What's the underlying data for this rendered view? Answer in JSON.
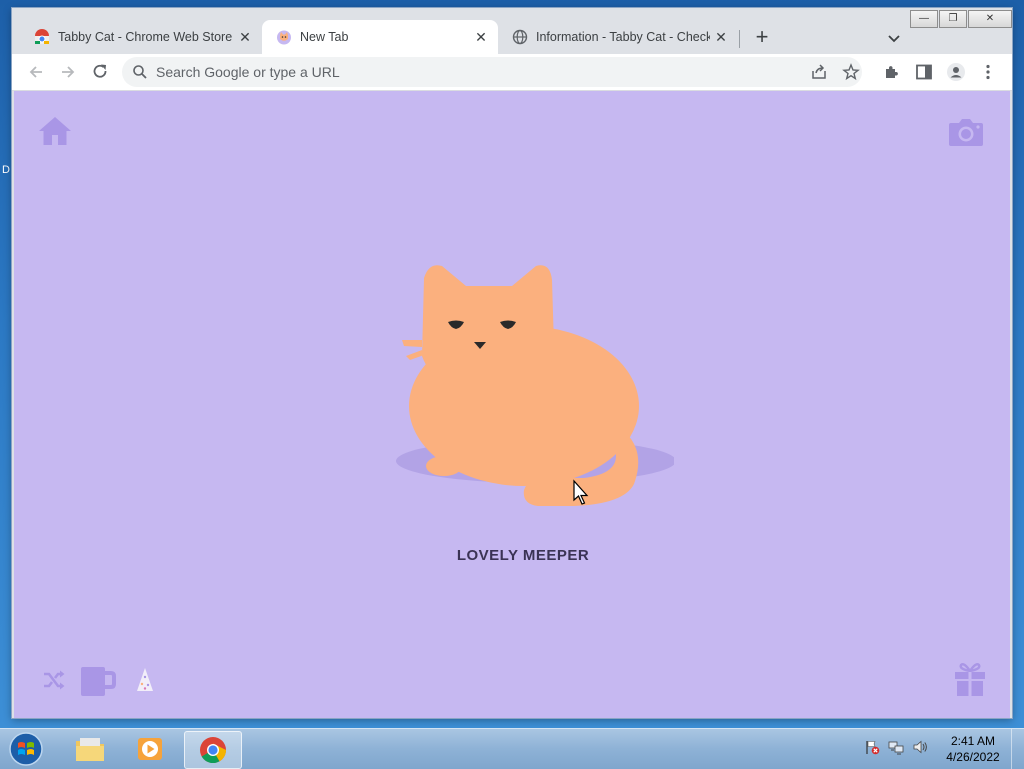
{
  "desktop": {
    "edge_letter": "D"
  },
  "browser": {
    "tabs": [
      {
        "title": "Tabby Cat - Chrome Web Store",
        "active": false
      },
      {
        "title": "New Tab",
        "active": true
      },
      {
        "title": "Information - Tabby Cat - Checkout",
        "active": false
      }
    ],
    "omnibox": {
      "placeholder": "Search Google or type a URL"
    }
  },
  "page": {
    "cat_name": "LOVELY MEEPER",
    "colors": {
      "background": "#c6b8f1",
      "cat": "#fbb07e",
      "shadow": "#b2a3e6",
      "icons": "#a996e6"
    }
  },
  "taskbar": {
    "clock": {
      "time": "2:41 AM",
      "date": "4/26/2022"
    }
  }
}
